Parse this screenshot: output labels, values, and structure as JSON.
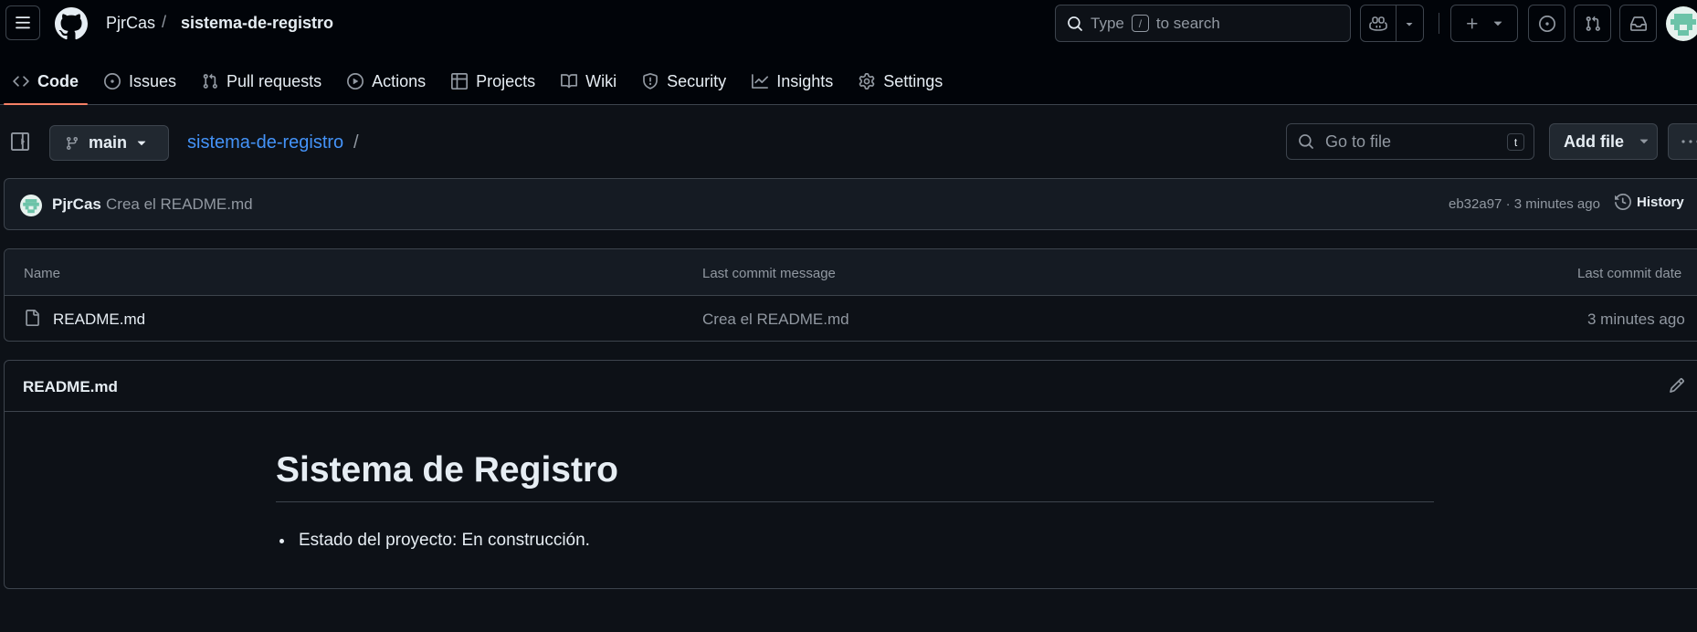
{
  "header": {
    "owner": "PjrCas",
    "separator": "/",
    "repo": "sistema-de-registro",
    "search": {
      "prefix": "Type",
      "key": "/",
      "suffix": "to search"
    }
  },
  "nav": {
    "tabs": [
      {
        "label": "Code",
        "icon": "code-icon",
        "active": true
      },
      {
        "label": "Issues",
        "icon": "issue-icon"
      },
      {
        "label": "Pull requests",
        "icon": "pull-request-icon"
      },
      {
        "label": "Actions",
        "icon": "play-icon"
      },
      {
        "label": "Projects",
        "icon": "table-icon"
      },
      {
        "label": "Wiki",
        "icon": "book-icon"
      },
      {
        "label": "Security",
        "icon": "shield-icon"
      },
      {
        "label": "Insights",
        "icon": "graph-icon"
      },
      {
        "label": "Settings",
        "icon": "gear-icon"
      }
    ]
  },
  "toolbar": {
    "branch": "main",
    "breadcrumb_repo": "sistema-de-registro",
    "breadcrumb_sep": "/",
    "goto_placeholder": "Go to file",
    "goto_key": "t",
    "add_file": "Add file"
  },
  "commit": {
    "author": "PjrCas",
    "message": "Crea el README.md",
    "meta": "eb32a97 · 3 minutes ago",
    "history": "History"
  },
  "files": {
    "headers": {
      "name": "Name",
      "message": "Last commit message",
      "date": "Last commit date"
    },
    "rows": [
      {
        "name": "README.md",
        "message": "Crea el README.md",
        "date": "3 minutes ago"
      }
    ]
  },
  "readme": {
    "title": "README.md",
    "heading": "Sistema de Registro",
    "items": [
      "Estado del proyecto: En construcción."
    ]
  },
  "colors": {
    "background": "#0d1117",
    "header_bg": "#010409",
    "border": "#3d444d",
    "link": "#4493f8",
    "active_tab_underline": "#f78166",
    "muted_text": "#9198a1"
  }
}
